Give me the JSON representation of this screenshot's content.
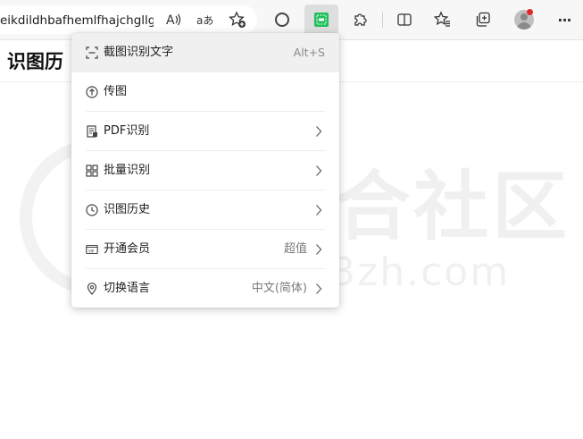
{
  "browser": {
    "address_text": "eikdildhbafhemlfhajchgllgi...",
    "toolbar_icons": [
      "read-aloud-icon",
      "translate-icon",
      "favorite-add-icon",
      "extension-circle-icon",
      "ocr-extension-icon",
      "extensions-puzzle-icon",
      "split-screen-icon",
      "favorites-icon",
      "collections-icon",
      "profile-avatar",
      "more-menu-icon"
    ],
    "translate_glyph": "aあ",
    "read_aloud_glyph": "A",
    "more_glyph": "···",
    "accent_green": "#1fbf5c",
    "notification_red": "#e3242b"
  },
  "page": {
    "title": "识图历",
    "watermark_text": "i3综合社区",
    "watermark_url": "www.i3zh.com"
  },
  "menu": {
    "items": [
      {
        "icon": "screenshot-icon",
        "label": "截图识别文字",
        "shortcut": "Alt+S"
      },
      {
        "icon": "upload-icon",
        "label": "传图"
      },
      {
        "icon": "pdf-icon",
        "label": "PDF识别",
        "has_submenu": true
      },
      {
        "icon": "batch-grid-icon",
        "label": "批量识别",
        "has_submenu": true
      },
      {
        "icon": "history-clock-icon",
        "label": "识图历史",
        "has_submenu": true
      },
      {
        "icon": "vip-icon",
        "label": "开通会员",
        "value": "超值",
        "has_submenu": true
      },
      {
        "icon": "location-pin-icon",
        "label": "切换语言",
        "value": "中文(简体)",
        "has_submenu": true
      }
    ]
  }
}
